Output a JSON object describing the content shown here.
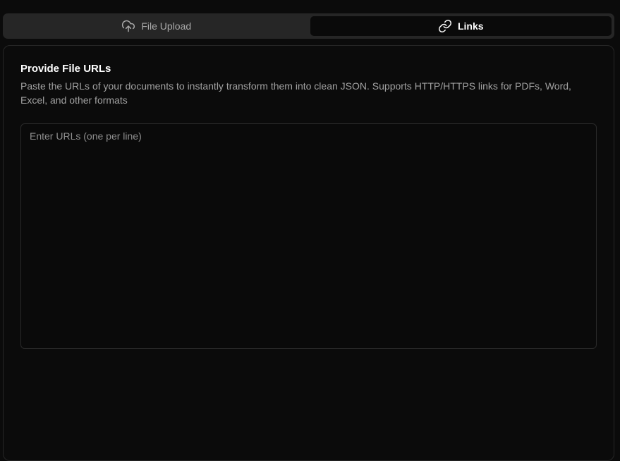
{
  "tabs": [
    {
      "label": "File Upload",
      "icon": "cloud-upload-icon",
      "active": false
    },
    {
      "label": "Links",
      "icon": "link-icon",
      "active": true
    }
  ],
  "panel": {
    "title": "Provide File URLs",
    "description": "Paste the URLs of your documents to instantly transform them into clean JSON. Supports HTTP/HTTPS links for PDFs, Word, Excel, and other formats",
    "input": {
      "placeholder": "Enter URLs (one per line)",
      "value": ""
    }
  },
  "colors": {
    "background": "#0b0b0b",
    "tabbar": "#262626",
    "active_tab": "#0a0a0a",
    "border": "#262626",
    "muted_text": "#a1a1a1"
  }
}
